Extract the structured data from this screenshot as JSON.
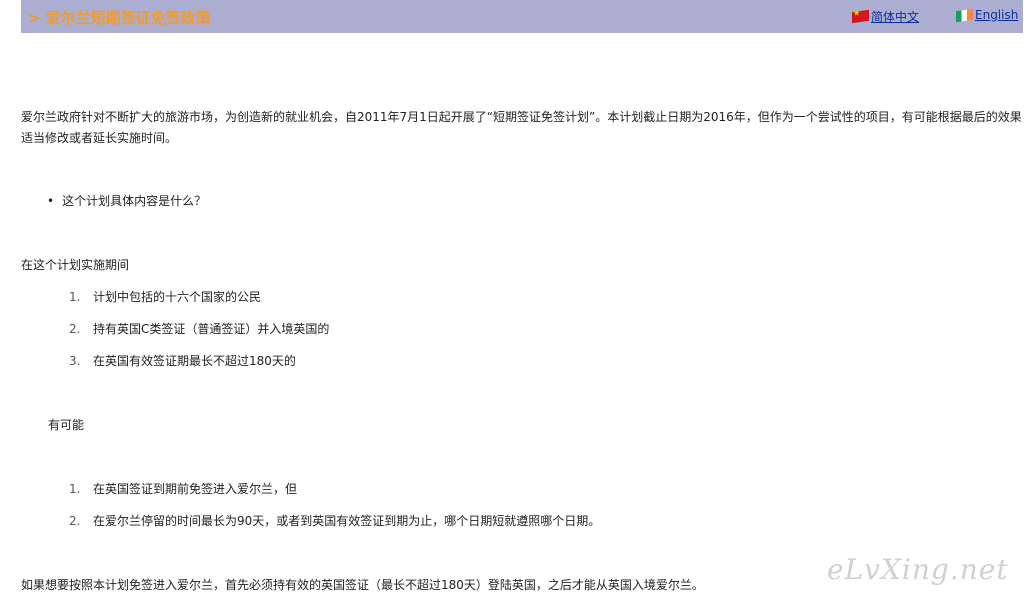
{
  "header": {
    "title": "> 爱尔兰短期签证免签政策",
    "lang_zh": "简体中文",
    "lang_en": "English"
  },
  "intro": "爱尔兰政府针对不断扩大的旅游市场，为创造新的就业机会，自2011年7月1日起开展了“短期签证免签计划”。本计划截止日期为2016年，但作为一个尝试性的项目，有可能根据最后的效果适当修改或者延长实施时间。",
  "bullet": "这个计划具体内容是什么？",
  "during_heading": "在这个计划实施期间",
  "list1": [
    {
      "num": "1.",
      "text": "计划中包括的十六个国家的公民"
    },
    {
      "num": "2.",
      "text": "持有英国C类签证（普通签证）并入境英国的"
    },
    {
      "num": "3.",
      "text": "在英国有效签证期最长不超过180天的"
    }
  ],
  "possible_heading": "有可能",
  "list2": [
    {
      "num": "1.",
      "text": "在英国签证到期前免签进入爱尔兰，但"
    },
    {
      "num": "2.",
      "text": "在爱尔兰停留的时间最长为90天，或者到英国有效签证到期为止，哪个日期短就遵照哪个日期。"
    }
  ],
  "footer_text": "如果想要按照本计划免签进入爱尔兰，首先必须持有效的英国签证（最长不超过180天）登陆英国，之后才能从英国入境爱尔兰。",
  "watermark": "eLvXing.net"
}
